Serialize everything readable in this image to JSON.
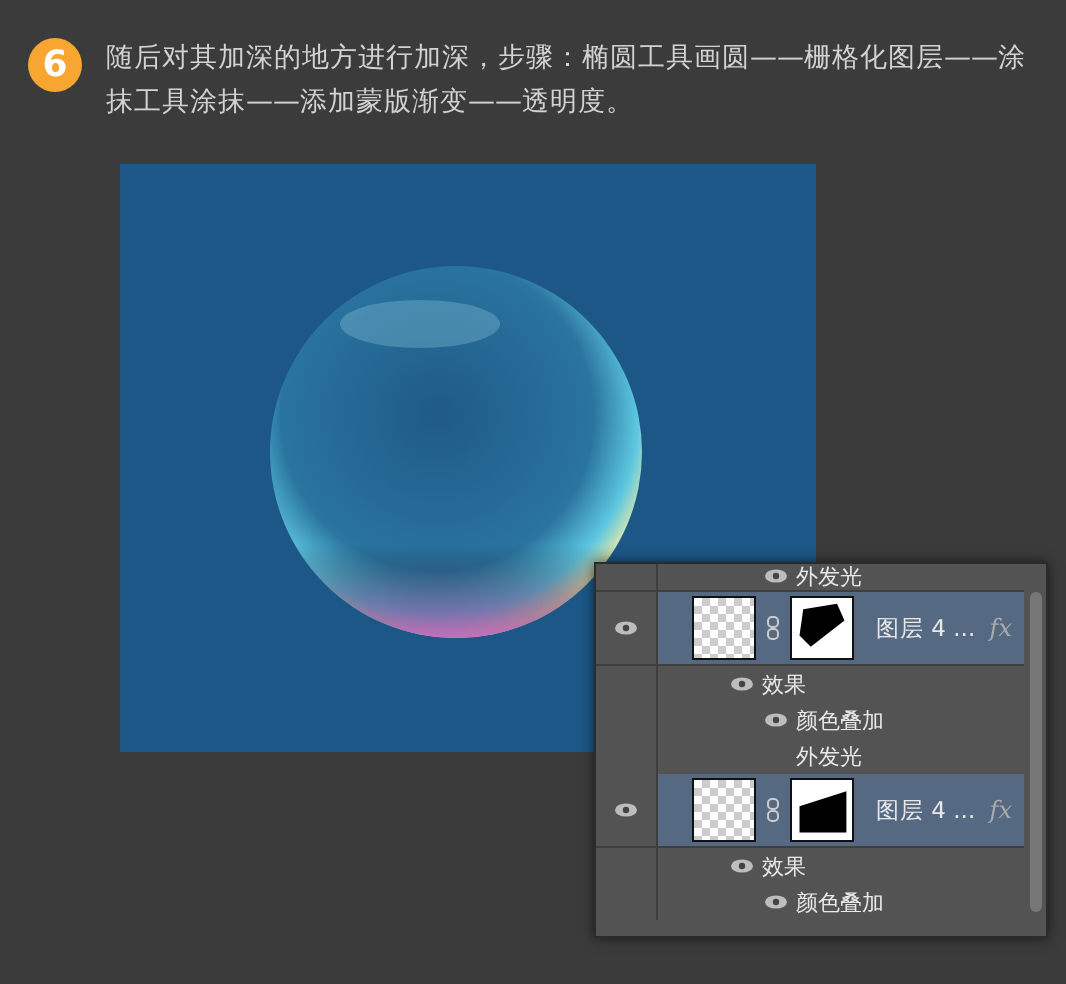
{
  "step": {
    "number": "6",
    "text": "随后对其加深的地方进行加深，步骤：椭圆工具画圆——栅格化图层——涂抹工具涂抹——添加蒙版渐变——透明度。"
  },
  "layers_panel": {
    "rows": [
      {
        "kind": "effect",
        "label": "外发光",
        "visible": true
      },
      {
        "kind": "layer",
        "name": "图层 4 ...",
        "fx": "fx",
        "selected": true,
        "visible": true,
        "children": [
          {
            "label": "效果",
            "visible": true,
            "children": [
              {
                "label": "颜色叠加",
                "visible": true
              },
              {
                "label": "外发光",
                "visible": false
              }
            ]
          }
        ]
      },
      {
        "kind": "layer",
        "name": "图层 4 ...",
        "fx": "fx",
        "selected": true,
        "visible": true,
        "children": [
          {
            "label": "效果",
            "visible": true,
            "children": [
              {
                "label": "颜色叠加",
                "visible": true
              }
            ]
          }
        ]
      }
    ]
  }
}
